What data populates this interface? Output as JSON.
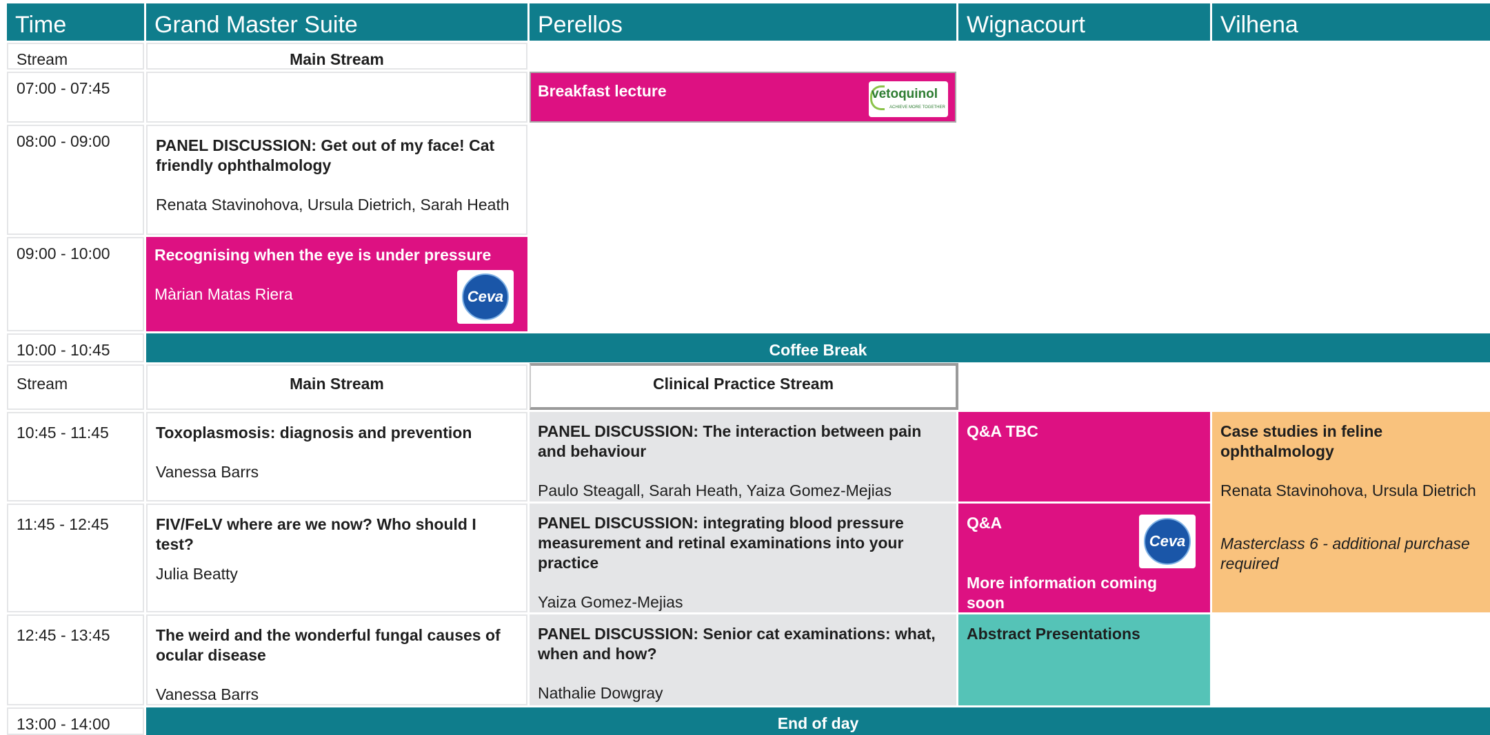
{
  "headers": {
    "time": "Time",
    "room1": "Grand Master Suite",
    "room2": "Perellos",
    "room3": "Wignacourt",
    "room4": "Vilhena"
  },
  "stream_label": "Stream",
  "main_stream": "Main Stream",
  "clinical_stream": "Clinical Practice Stream",
  "times": {
    "t1": "07:00 - 07:45",
    "t2": "08:00 - 09:00",
    "t3": "09:00 - 10:00",
    "t4": "10:00 - 10:45",
    "t5": "10:45 - 11:45",
    "t6": "11:45 - 12:45",
    "t7": "12:45 - 13:45",
    "t8": "13:00 - 14:00"
  },
  "breakfast": {
    "title": "Breakfast lecture",
    "sponsor": "vetoquinol",
    "sponsor_tagline": "ACHIEVE MORE TOGETHER"
  },
  "s0800": {
    "title": "PANEL DISCUSSION: Get out of my face! Cat friendly ophthalmology",
    "speakers": "Renata Stavinohova, Ursula Dietrich, Sarah Heath"
  },
  "s0900": {
    "title": "Recognising when the eye is under pressure",
    "speakers": "Màrian Matas Riera",
    "sponsor": "Ceva"
  },
  "coffee": "Coffee Break",
  "s1045_main": {
    "title": "Toxoplasmosis: diagnosis and prevention",
    "speakers": "Vanessa Barrs"
  },
  "s1045_clin": {
    "title": "PANEL DISCUSSION: The interaction between pain and behaviour",
    "speakers": "Paulo Steagall, Sarah Heath, Yaiza Gomez-Mejias"
  },
  "s1045_wig": {
    "title": "Q&A TBC"
  },
  "vilhena": {
    "title": "Case studies in feline ophthalmology",
    "speakers": "Renata Stavinohova, Ursula Dietrich",
    "note": "Masterclass 6 - additional purchase required"
  },
  "s1145_main": {
    "title": "FIV/FeLV where are we now? Who should I test?",
    "speakers": "Julia Beatty"
  },
  "s1145_clin": {
    "title": "PANEL DISCUSSION: integrating blood pressure measurement and retinal examinations into your practice",
    "speakers": "Yaiza Gomez-Mejias"
  },
  "s1145_wig": {
    "title": "Q&A",
    "info": "More information coming soon",
    "sponsor": "Ceva"
  },
  "s1245_main": {
    "title": "The weird and the wonderful fungal causes of ocular disease",
    "speakers": "Vanessa Barrs"
  },
  "s1245_clin": {
    "title": "PANEL DISCUSSION: Senior cat examinations: what, when and how?",
    "speakers": "Nathalie Dowgray"
  },
  "s1245_wig": {
    "title": "Abstract Presentations"
  },
  "end": "End of day",
  "colors": {
    "teal_header": "#0f7d8c",
    "magenta": "#dd1182",
    "grey": "#e4e5e7",
    "mint": "#55c3b7",
    "peach": "#f9c27d"
  }
}
